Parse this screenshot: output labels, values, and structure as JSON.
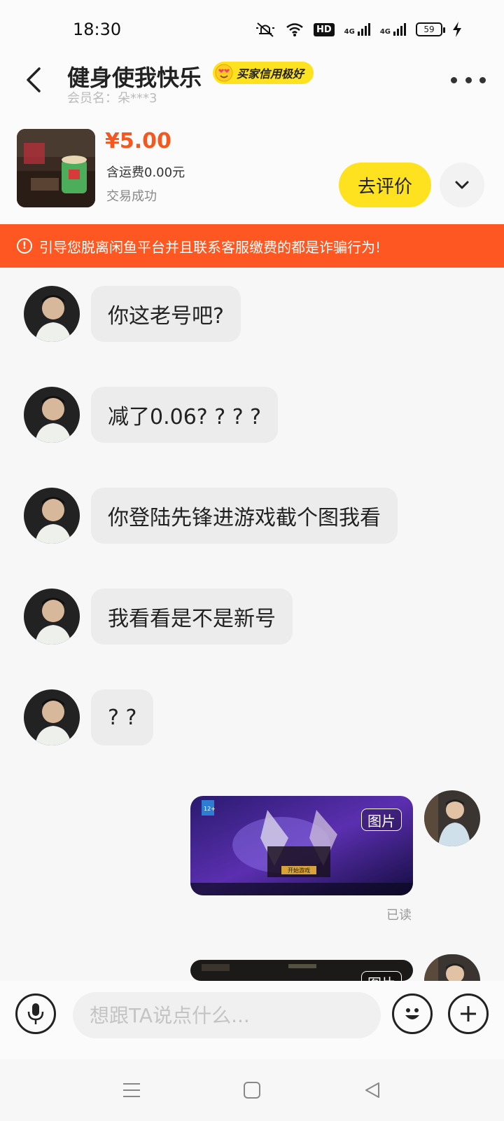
{
  "status_bar": {
    "time": "18:30",
    "network_label": "4G",
    "battery_level": "59",
    "icons": [
      "mute-icon",
      "wifi-icon",
      "hd-icon",
      "signal-icon",
      "signal-icon",
      "battery-icon",
      "charging-icon"
    ]
  },
  "header": {
    "title": "健身使我快乐",
    "credit_badge": "买家信用极好",
    "member_label": "会员名：朵***3"
  },
  "product": {
    "price": "¥5.00",
    "shipping": "含运费0.00元",
    "status": "交易成功",
    "review_button": "去评价"
  },
  "warning": {
    "text": "引导您脱离闲鱼平台并且联系客服缴费的都是诈骗行为!"
  },
  "messages": [
    {
      "side": "left",
      "text": "你这老号吧?"
    },
    {
      "side": "left",
      "text": "减了0.06? ? ? ?"
    },
    {
      "side": "left",
      "text": "你登陆先锋进游戏截个图我看"
    },
    {
      "side": "left",
      "text": "我看看是不是新号"
    },
    {
      "side": "left",
      "text": "? ?"
    },
    {
      "side": "right",
      "type": "image",
      "tag": "图片",
      "read": "已读"
    },
    {
      "side": "right",
      "type": "image",
      "tag": "图片"
    }
  ],
  "image_game_text": {
    "start_button": "开始游戏",
    "age_badge": "12+"
  },
  "input": {
    "placeholder": "想跟TA说点什么..."
  },
  "colors": {
    "accent_yellow": "#ffe21f",
    "price_orange": "#f5581e",
    "warning_bg": "#ff5722"
  }
}
